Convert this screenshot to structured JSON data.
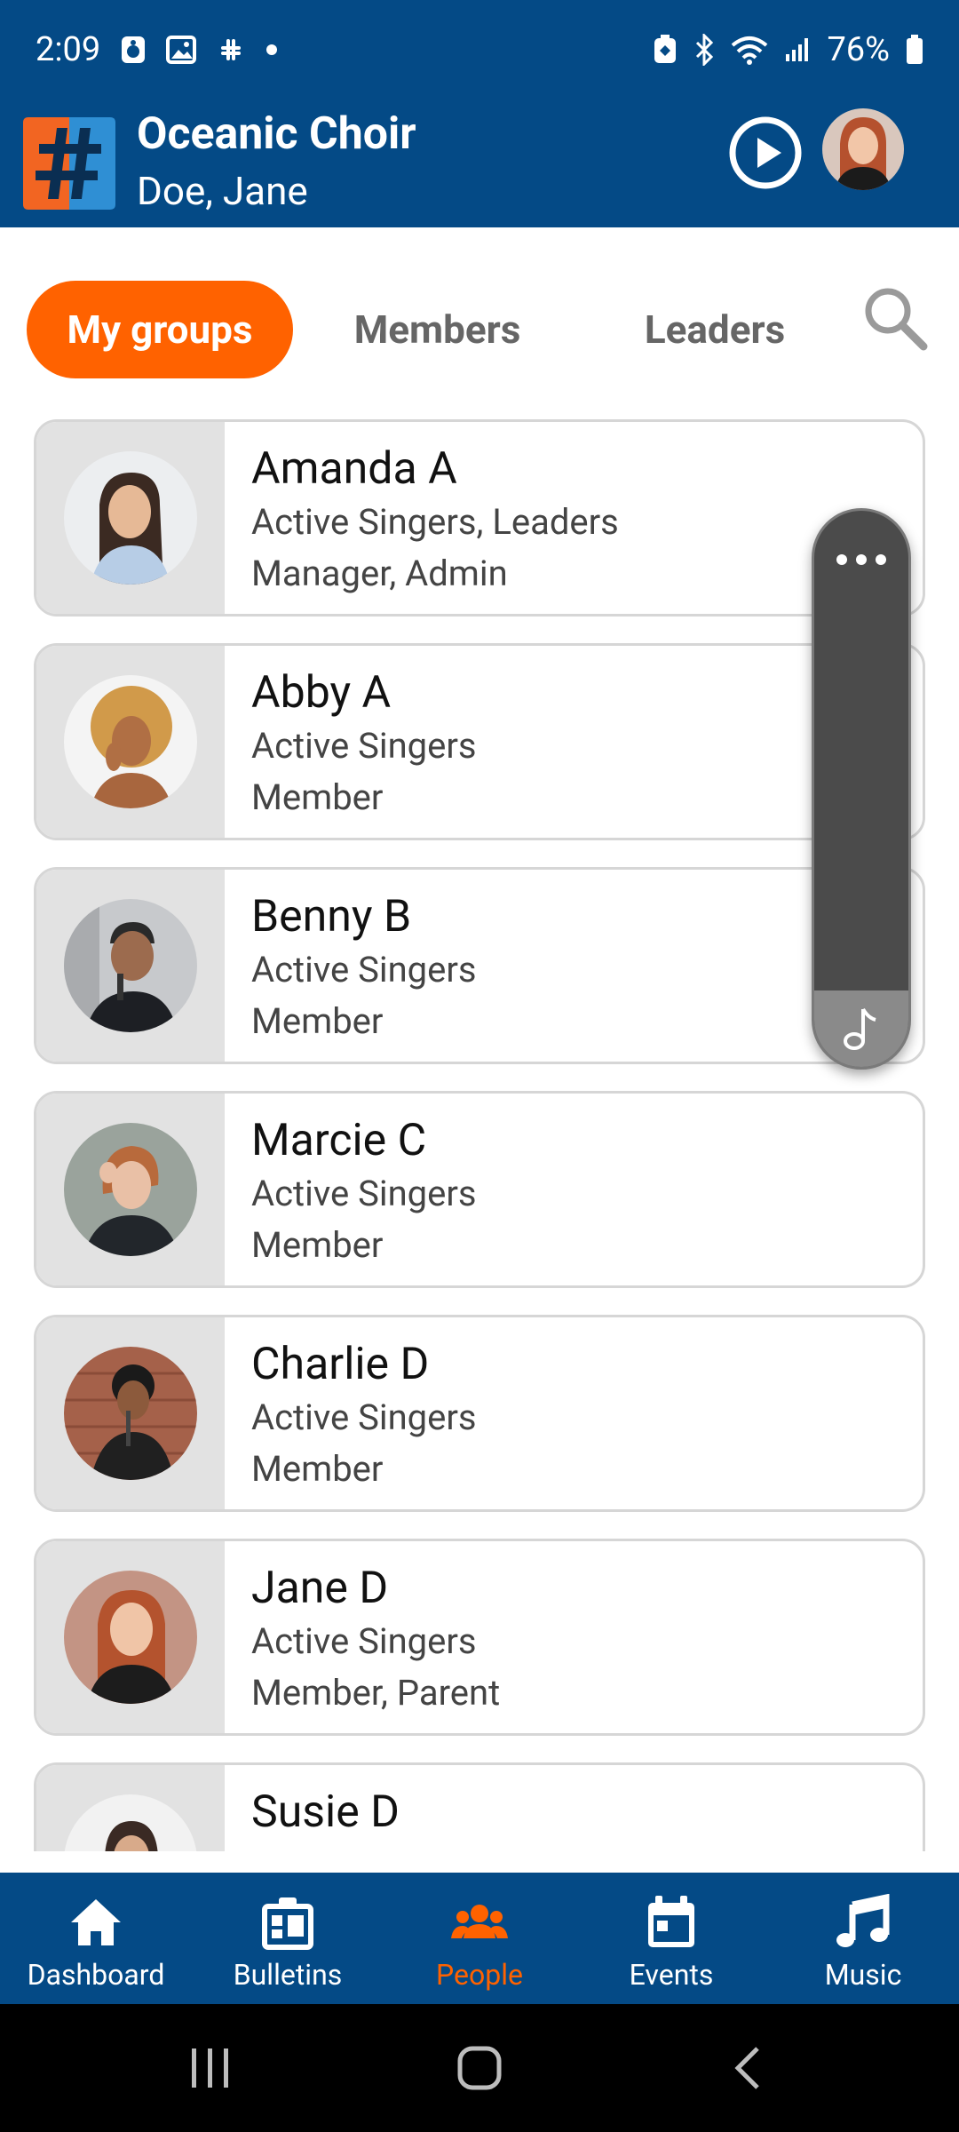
{
  "status": {
    "time": "2:09",
    "battery": "76%",
    "icons_left": [
      "alarm-icon",
      "gallery-icon",
      "slack-icon",
      "notification-dot-icon"
    ],
    "icons_right": [
      "battery-saver-icon",
      "bluetooth-icon",
      "wifi-icon",
      "signal-icon",
      "battery-icon"
    ]
  },
  "header": {
    "title": "Oceanic Choir",
    "subtitle": "Doe, Jane"
  },
  "tabs": [
    {
      "label": "My groups",
      "active": true
    },
    {
      "label": "Members",
      "active": false
    },
    {
      "label": "Leaders",
      "active": false
    }
  ],
  "members": [
    {
      "name": "Amanda A",
      "groups": "Active Singers, Leaders",
      "roles": "Manager, Admin"
    },
    {
      "name": "Abby A",
      "groups": "Active Singers",
      "roles": "Member"
    },
    {
      "name": "Benny B",
      "groups": "Active Singers",
      "roles": "Member"
    },
    {
      "name": "Marcie C",
      "groups": "Active Singers",
      "roles": "Member"
    },
    {
      "name": "Charlie D",
      "groups": "Active Singers",
      "roles": "Member"
    },
    {
      "name": "Jane D",
      "groups": "Active Singers",
      "roles": "Member, Parent"
    },
    {
      "name": "Susie D",
      "groups": "",
      "roles": ""
    }
  ],
  "bottom_nav": [
    {
      "label": "Dashboard",
      "icon": "home-icon",
      "active": false
    },
    {
      "label": "Bulletins",
      "icon": "bulletin-board-icon",
      "active": false
    },
    {
      "label": "People",
      "icon": "people-icon",
      "active": true
    },
    {
      "label": "Events",
      "icon": "calendar-icon",
      "active": false
    },
    {
      "label": "Music",
      "icon": "music-note-icon",
      "active": false
    }
  ],
  "colors": {
    "brand_blue": "#044a86",
    "accent_orange": "#ff6200"
  }
}
